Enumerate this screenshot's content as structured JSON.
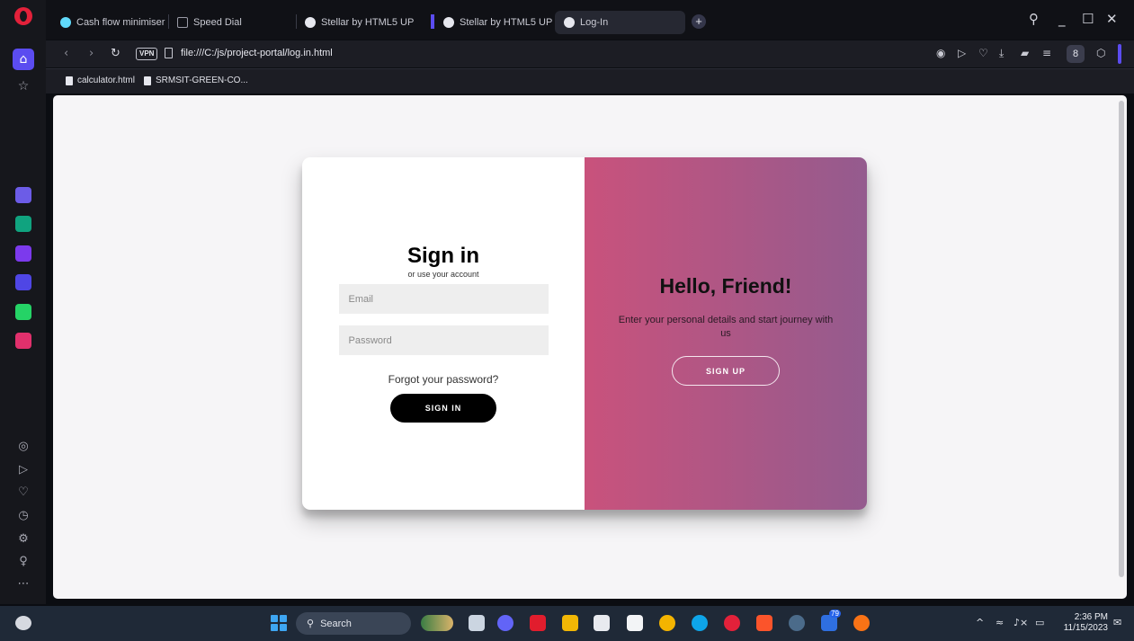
{
  "browser": {
    "tabs": [
      {
        "label": "Cash flow minimiser",
        "active": false
      },
      {
        "label": "Speed Dial",
        "active": false
      },
      {
        "label": "Stellar by HTML5 UP",
        "active": false
      },
      {
        "label": "Stellar by HTML5 UP",
        "active": false
      },
      {
        "label": "Log-In",
        "active": true
      }
    ],
    "vpn_label": "VPN",
    "url": "file:///C:/js/project-portal/log.in.html",
    "profile_initial": "8",
    "bookmarks": [
      "calculator.html",
      "SRMSIT-GREEN-CO..."
    ]
  },
  "login": {
    "signin_title": "Sign in",
    "signin_subtitle": "or use your account",
    "email_placeholder": "Email",
    "password_placeholder": "Password",
    "forgot_link": "Forgot your password?",
    "signin_button": "SIGN IN",
    "overlay_title": "Hello, Friend!",
    "overlay_text": "Enter your personal details and start journey with us",
    "signup_button": "SIGN UP"
  },
  "taskbar": {
    "search_label": "Search",
    "time": "2:36 PM",
    "date": "11/15/2023",
    "badge_count": "79"
  },
  "colors": {
    "accent": "#5b4cf0",
    "overlay_gradient_start": "#c9527c",
    "overlay_gradient_end": "#945b8e"
  }
}
